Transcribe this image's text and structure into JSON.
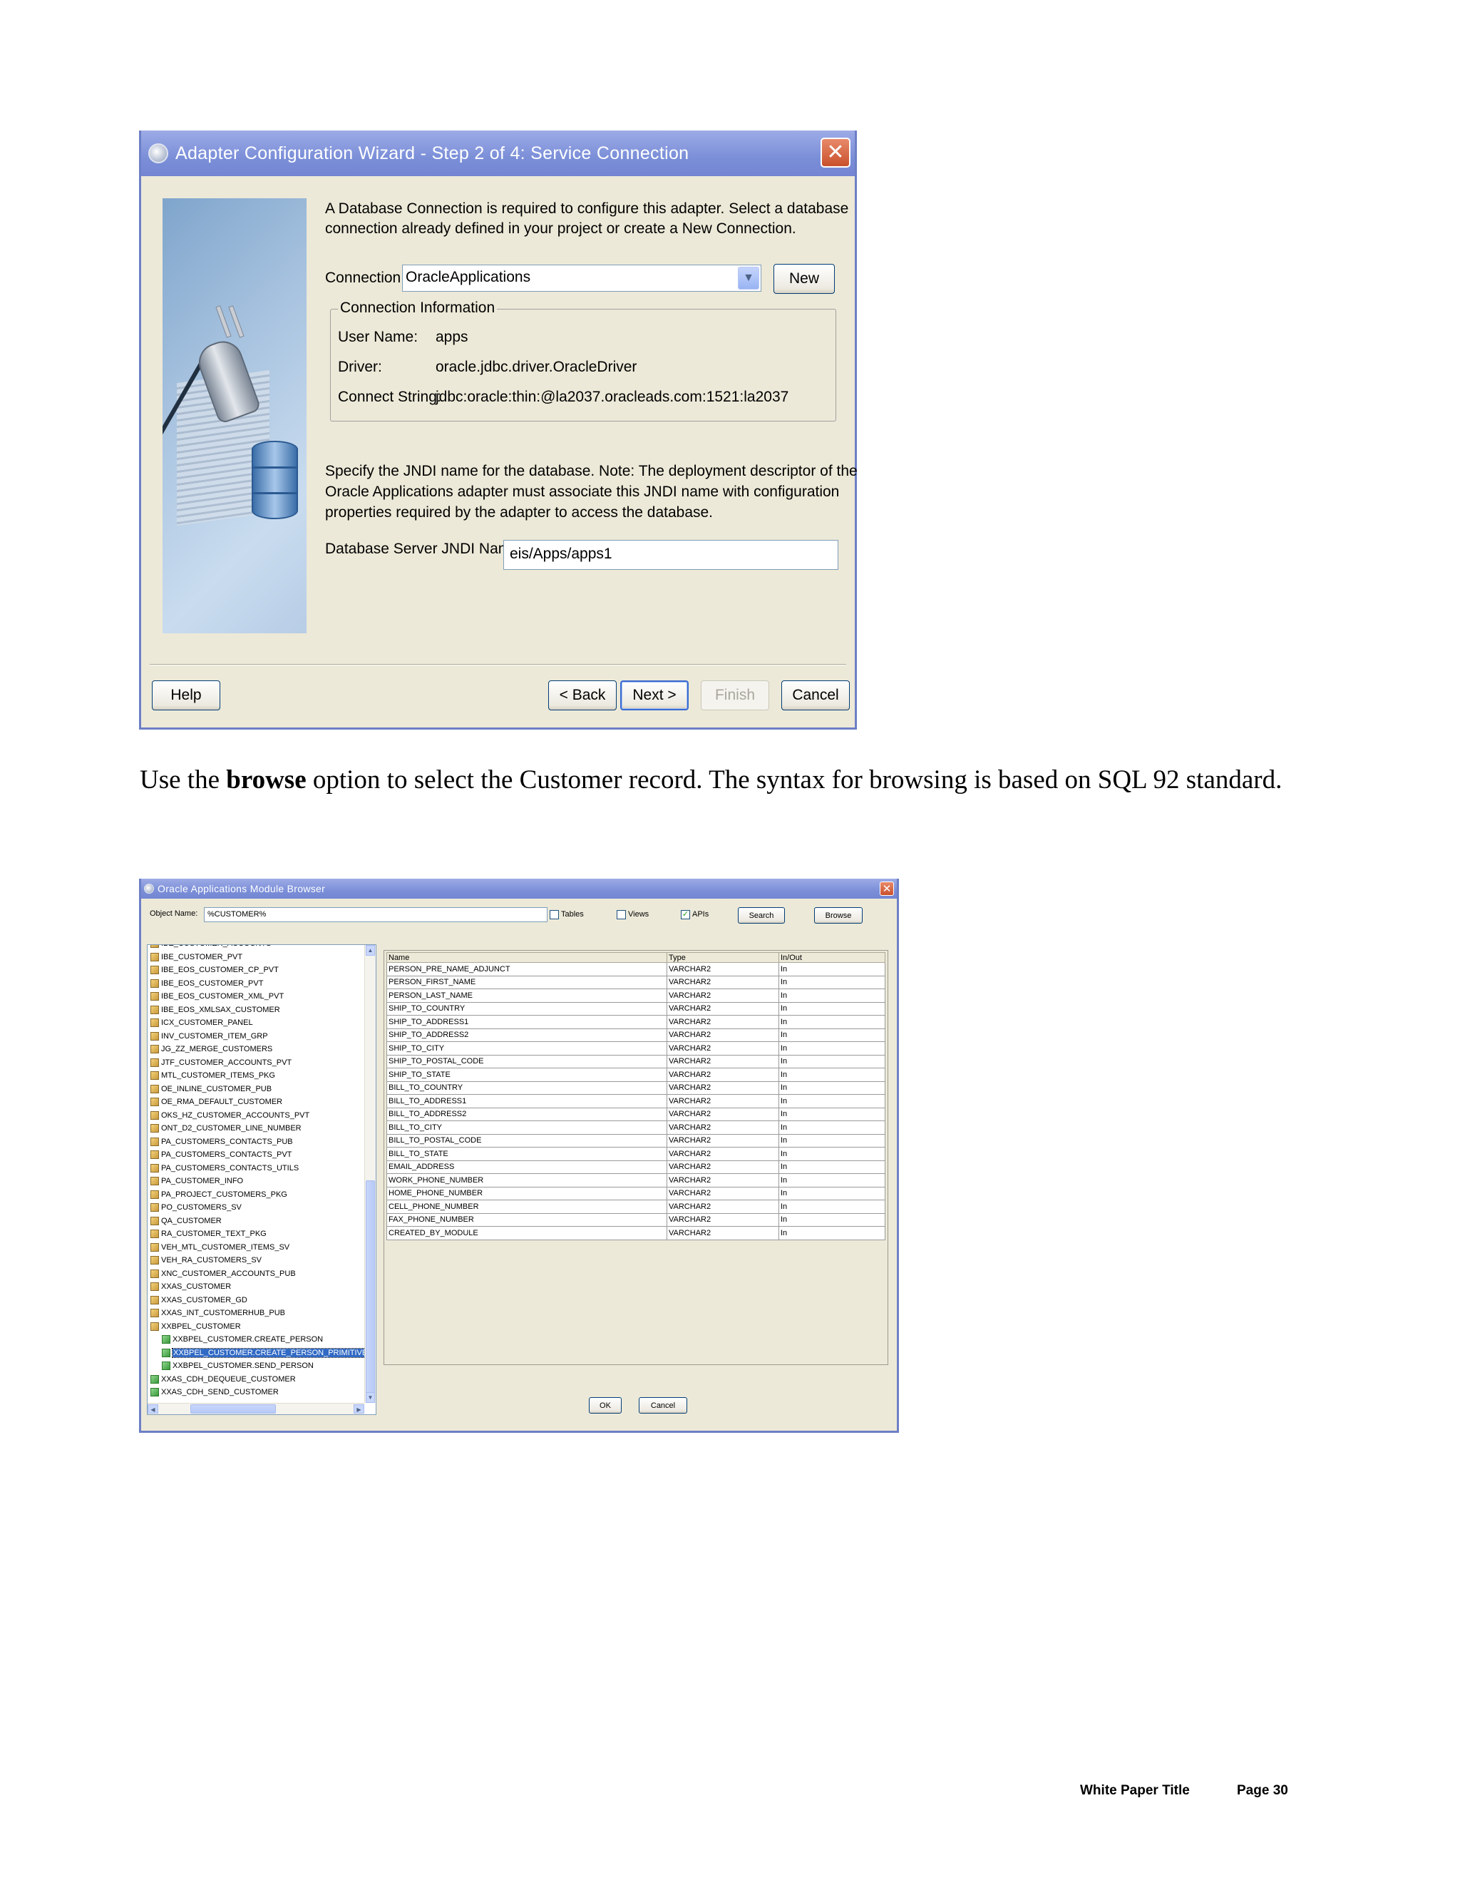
{
  "wizard": {
    "title": "Adapter Configuration Wizard - Step 2 of 4: Service Connection",
    "intro_line1": "A Database Connection is required to configure this adapter. Select a database",
    "intro_line2": "connection already defined in your project or create a New Connection.",
    "connection_label": "Connection:",
    "connection_value": "OracleApplications",
    "new_button": "New",
    "info_legend": "Connection Information",
    "info": [
      {
        "label": "User Name:",
        "value": "apps"
      },
      {
        "label": "Driver:",
        "value": "oracle.jdbc.driver.OracleDriver"
      },
      {
        "label": "Connect String:",
        "value": "jdbc:oracle:thin:@la2037.oracleads.com:1521:la2037"
      }
    ],
    "jndi_text_line1": "Specify the JNDI name for the database.  Note: The deployment descriptor of the",
    "jndi_text_line2": "Oracle Applications adapter must associate this JNDI name with configuration",
    "jndi_text_line3": "properties required by the adapter to access the database.",
    "jndi_label": "Database Server JNDI Name:",
    "jndi_value": "eis/Apps/apps1",
    "buttons": {
      "help": "Help",
      "back": "< Back",
      "next": "Next >",
      "finish": "Finish",
      "cancel": "Cancel"
    }
  },
  "paragraph": {
    "before": "Use the ",
    "bold": "browse",
    "after": " option to select the Customer record. The syntax for browsing is based on SQL 92 standard."
  },
  "browser": {
    "title": "Oracle Applications Module Browser",
    "object_name_label": "Object Name:",
    "object_name_value": "%CUSTOMER%",
    "tables_label": "Tables",
    "views_label": "Views",
    "apis_label": "APIs",
    "apis_checked": true,
    "search_button": "Search",
    "browse_button": "Browse",
    "ok_button": "OK",
    "cancel_button": "Cancel",
    "tree": [
      {
        "label": "IBE_CUSTOMER_ACCOUNTS",
        "level": 0
      },
      {
        "label": "IBE_CUSTOMER_PVT",
        "level": 0
      },
      {
        "label": "IBE_EOS_CUSTOMER_CP_PVT",
        "level": 0
      },
      {
        "label": "IBE_EOS_CUSTOMER_PVT",
        "level": 0
      },
      {
        "label": "IBE_EOS_CUSTOMER_XML_PVT",
        "level": 0
      },
      {
        "label": "IBE_EOS_XMLSAX_CUSTOMER",
        "level": 0
      },
      {
        "label": "ICX_CUSTOMER_PANEL",
        "level": 0
      },
      {
        "label": "INV_CUSTOMER_ITEM_GRP",
        "level": 0
      },
      {
        "label": "JG_ZZ_MERGE_CUSTOMERS",
        "level": 0
      },
      {
        "label": "JTF_CUSTOMER_ACCOUNTS_PVT",
        "level": 0
      },
      {
        "label": "MTL_CUSTOMER_ITEMS_PKG",
        "level": 0
      },
      {
        "label": "OE_INLINE_CUSTOMER_PUB",
        "level": 0
      },
      {
        "label": "OE_RMA_DEFAULT_CUSTOMER",
        "level": 0
      },
      {
        "label": "OKS_HZ_CUSTOMER_ACCOUNTS_PVT",
        "level": 0
      },
      {
        "label": "ONT_D2_CUSTOMER_LINE_NUMBER",
        "level": 0
      },
      {
        "label": "PA_CUSTOMERS_CONTACTS_PUB",
        "level": 0
      },
      {
        "label": "PA_CUSTOMERS_CONTACTS_PVT",
        "level": 0
      },
      {
        "label": "PA_CUSTOMERS_CONTACTS_UTILS",
        "level": 0
      },
      {
        "label": "PA_CUSTOMER_INFO",
        "level": 0
      },
      {
        "label": "PA_PROJECT_CUSTOMERS_PKG",
        "level": 0
      },
      {
        "label": "PO_CUSTOMERS_SV",
        "level": 0
      },
      {
        "label": "QA_CUSTOMER",
        "level": 0
      },
      {
        "label": "RA_CUSTOMER_TEXT_PKG",
        "level": 0
      },
      {
        "label": "VEH_MTL_CUSTOMER_ITEMS_SV",
        "level": 0
      },
      {
        "label": "VEH_RA_CUSTOMERS_SV",
        "level": 0
      },
      {
        "label": "XNC_CUSTOMER_ACCOUNTS_PUB",
        "level": 0
      },
      {
        "label": "XXAS_CUSTOMER",
        "level": 0
      },
      {
        "label": "XXAS_CUSTOMER_GD",
        "level": 0
      },
      {
        "label": "XXAS_INT_CUSTOMERHUB_PUB",
        "level": 0
      },
      {
        "label": "XXBPEL_CUSTOMER",
        "level": 0
      },
      {
        "label": "XXBPEL_CUSTOMER.CREATE_PERSON",
        "level": 1
      },
      {
        "label": "XXBPEL_CUSTOMER.CREATE_PERSON_PRIMITIVE",
        "level": 1,
        "selected": true
      },
      {
        "label": "XXBPEL_CUSTOMER.SEND_PERSON",
        "level": 1
      },
      {
        "label": "XXAS_CDH_DEQUEUE_CUSTOMER",
        "level": 2
      },
      {
        "label": "XXAS_CDH_SEND_CUSTOMER",
        "level": 2
      }
    ],
    "columns": [
      "Name",
      "Type",
      "In/Out"
    ],
    "rows": [
      [
        "PERSON_PRE_NAME_ADJUNCT",
        "VARCHAR2",
        "In"
      ],
      [
        "PERSON_FIRST_NAME",
        "VARCHAR2",
        "In"
      ],
      [
        "PERSON_LAST_NAME",
        "VARCHAR2",
        "In"
      ],
      [
        "SHIP_TO_COUNTRY",
        "VARCHAR2",
        "In"
      ],
      [
        "SHIP_TO_ADDRESS1",
        "VARCHAR2",
        "In"
      ],
      [
        "SHIP_TO_ADDRESS2",
        "VARCHAR2",
        "In"
      ],
      [
        "SHIP_TO_CITY",
        "VARCHAR2",
        "In"
      ],
      [
        "SHIP_TO_POSTAL_CODE",
        "VARCHAR2",
        "In"
      ],
      [
        "SHIP_TO_STATE",
        "VARCHAR2",
        "In"
      ],
      [
        "BILL_TO_COUNTRY",
        "VARCHAR2",
        "In"
      ],
      [
        "BILL_TO_ADDRESS1",
        "VARCHAR2",
        "In"
      ],
      [
        "BILL_TO_ADDRESS2",
        "VARCHAR2",
        "In"
      ],
      [
        "BILL_TO_CITY",
        "VARCHAR2",
        "In"
      ],
      [
        "BILL_TO_POSTAL_CODE",
        "VARCHAR2",
        "In"
      ],
      [
        "BILL_TO_STATE",
        "VARCHAR2",
        "In"
      ],
      [
        "EMAIL_ADDRESS",
        "VARCHAR2",
        "In"
      ],
      [
        "WORK_PHONE_NUMBER",
        "VARCHAR2",
        "In"
      ],
      [
        "HOME_PHONE_NUMBER",
        "VARCHAR2",
        "In"
      ],
      [
        "CELL_PHONE_NUMBER",
        "VARCHAR2",
        "In"
      ],
      [
        "FAX_PHONE_NUMBER",
        "VARCHAR2",
        "In"
      ],
      [
        "CREATED_BY_MODULE",
        "VARCHAR2",
        "In"
      ]
    ]
  },
  "footer": {
    "doc_title": "White Paper Title",
    "page": "Page 30"
  }
}
